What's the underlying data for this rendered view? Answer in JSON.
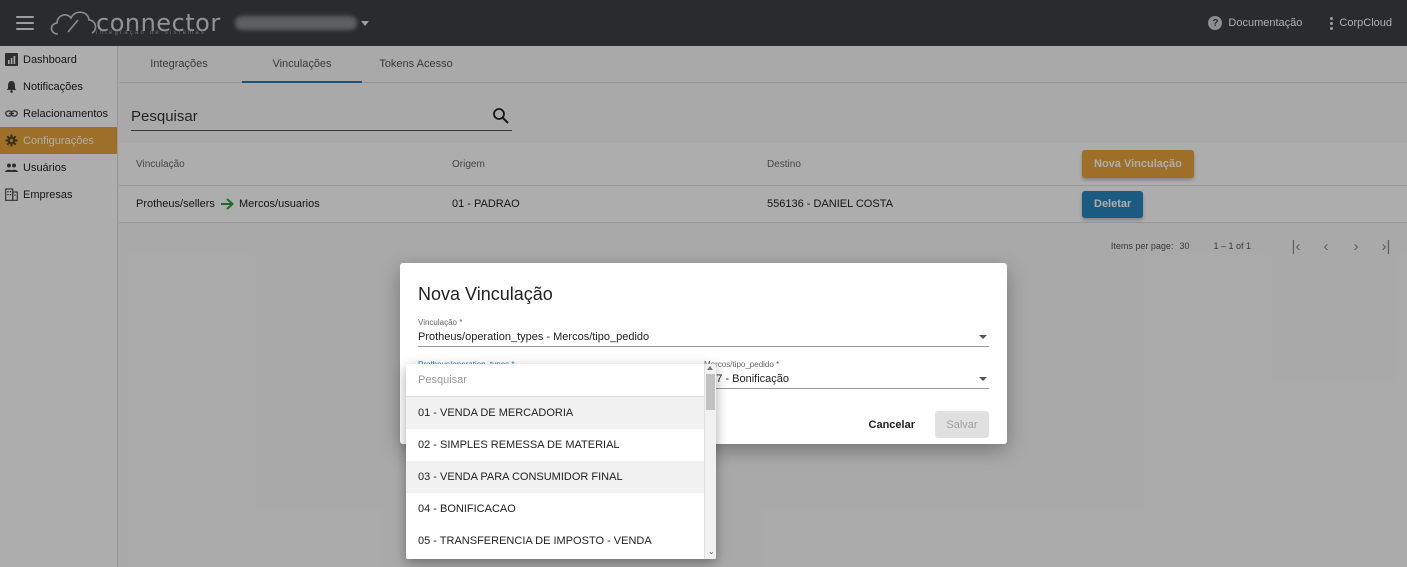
{
  "header": {
    "logo_text": "connector",
    "logo_subtitle": "integração de sistemas",
    "doc_link": "Documentação",
    "account_link": "CorpCloud"
  },
  "sidebar": {
    "items": [
      {
        "label": "Dashboard",
        "icon": "bar-chart-icon"
      },
      {
        "label": "Notificações",
        "icon": "bell-icon"
      },
      {
        "label": "Relacionamentos",
        "icon": "link-icon"
      },
      {
        "label": "Configurações",
        "icon": "gear-icon",
        "active": true
      },
      {
        "label": "Usuários",
        "icon": "people-icon"
      },
      {
        "label": "Empresas",
        "icon": "building-icon"
      }
    ]
  },
  "main": {
    "tabs": [
      {
        "label": "Integrações"
      },
      {
        "label": "Vinculações",
        "active": true
      },
      {
        "label": "Tokens Acesso"
      }
    ],
    "search": {
      "placeholder": "Pesquisar"
    },
    "table": {
      "headers": [
        "Vinculação",
        "Origem",
        "Destino"
      ],
      "new_button": "Nova Vinculação",
      "rows": [
        {
          "vinc_from": "Protheus/sellers",
          "vinc_to": "Mercos/usuarios",
          "origem": "01 - PADRAO",
          "destino": "556136 - DANIEL COSTA",
          "action": "Deletar"
        }
      ]
    },
    "paginator": {
      "items_label": "Items per page:",
      "page_size": "30",
      "range": "1 – 1 of 1"
    }
  },
  "dialog": {
    "title": "Nova Vinculação",
    "vinculacao_label": "Vinculação *",
    "vinculacao_value": "Protheus/operation_types - Mercos/tipo_pedido",
    "origin_label": "Protheus/operation_types *",
    "dest_label": "Mercos/tipo_pedido *",
    "dest_value": "817 - Bonificação",
    "cancel": "Cancelar",
    "save": "Salvar"
  },
  "dropdown": {
    "search_placeholder": "Pesquisar",
    "options": [
      "01 - VENDA DE MERCADORIA",
      "02 - SIMPLES REMESSA DE MATERIAL",
      "03 - VENDA PARA CONSUMIDOR FINAL",
      "04 - BONIFICACAO",
      "05 - TRANSFERENCIA DE IMPOSTO - VENDA"
    ]
  },
  "colors": {
    "topbar": "#3d4043",
    "accent_orange": "#e7a43c",
    "accent_blue": "#2a86bf",
    "tab_indicator": "#2a7bb8",
    "arrow_green": "#2e9e3e"
  }
}
